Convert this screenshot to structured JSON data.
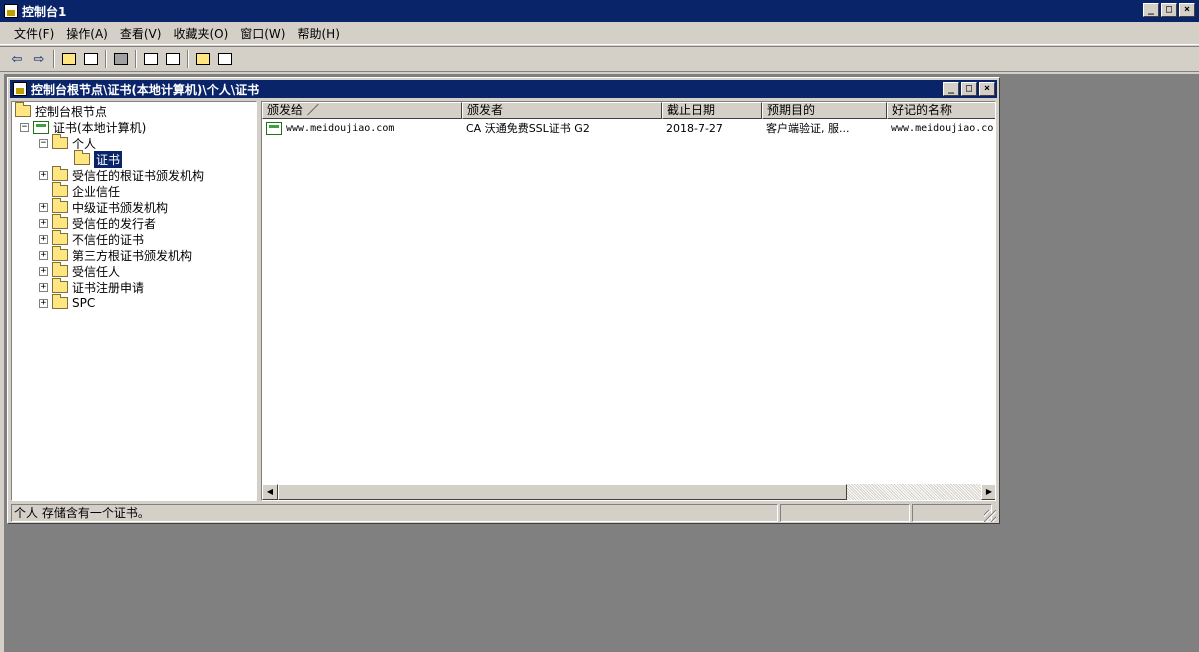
{
  "window": {
    "title": "控制台1",
    "controls": {
      "minimize": "_",
      "maximize": "□",
      "close": "×"
    }
  },
  "menu": [
    {
      "label": "文件(F)"
    },
    {
      "label": "操作(A)"
    },
    {
      "label": "查看(V)"
    },
    {
      "label": "收藏夹(O)"
    },
    {
      "label": "窗口(W)"
    },
    {
      "label": "帮助(H)"
    }
  ],
  "toolbar": {
    "back": "⇦",
    "forward": "⇨"
  },
  "child_window": {
    "title": "控制台根节点\\证书(本地计算机)\\个人\\证书"
  },
  "tree": {
    "root": "控制台根节点",
    "certs_local": "证书(本地计算机)",
    "personal": "个人",
    "personal_certs": "证书",
    "trusted_root": "受信任的根证书颁发机构",
    "enterprise_trust": "企业信任",
    "intermediate": "中级证书颁发机构",
    "trusted_publishers": "受信任的发行者",
    "untrusted": "不信任的证书",
    "third_party_root": "第三方根证书颁发机构",
    "trusted_people": "受信任人",
    "enrollment_requests": "证书注册申请",
    "spc": "SPC",
    "plus": "+",
    "minus": "−"
  },
  "list": {
    "columns": [
      "颁发给 ／",
      "颁发者",
      "截止日期",
      "预期目的",
      "好记的名称"
    ],
    "rows": [
      {
        "issued_to": "www.meidoujiao.com",
        "issued_by": "CA 沃通免费SSL证书 G2",
        "expiry": "2018-7-27",
        "purpose": "客户端验证, 服...",
        "friendly_name": "www.meidoujiao.co"
      }
    ]
  },
  "scrollbar": {
    "left": "◀",
    "right": "▶"
  },
  "status": {
    "text": "个人 存储含有一个证书。"
  }
}
